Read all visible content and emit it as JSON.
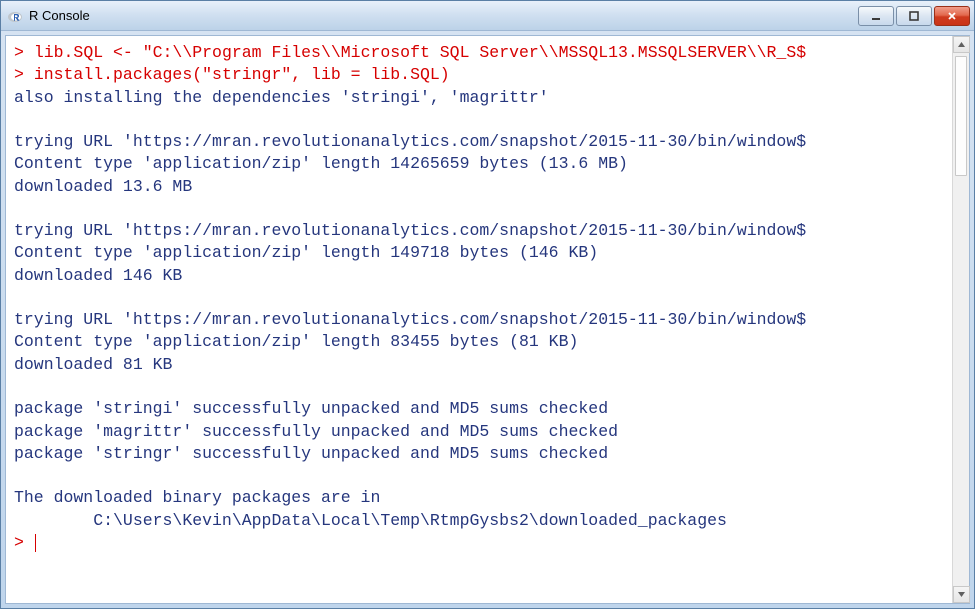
{
  "window": {
    "title": "R Console"
  },
  "console": {
    "prompt": ">",
    "lines": {
      "cmd1": "lib.SQL <- \"C:\\\\Program Files\\\\Microsoft SQL Server\\\\MSSQL13.MSSQLSERVER\\\\R_S$",
      "cmd2": "install.packages(\"stringr\", lib = lib.SQL)",
      "out1": "also installing the dependencies 'stringi', 'magrittr'",
      "out2": "trying URL 'https://mran.revolutionanalytics.com/snapshot/2015-11-30/bin/window$",
      "out3": "Content type 'application/zip' length 14265659 bytes (13.6 MB)",
      "out4": "downloaded 13.6 MB",
      "out5": "trying URL 'https://mran.revolutionanalytics.com/snapshot/2015-11-30/bin/window$",
      "out6": "Content type 'application/zip' length 149718 bytes (146 KB)",
      "out7": "downloaded 146 KB",
      "out8": "trying URL 'https://mran.revolutionanalytics.com/snapshot/2015-11-30/bin/window$",
      "out9": "Content type 'application/zip' length 83455 bytes (81 KB)",
      "out10": "downloaded 81 KB",
      "out11": "package 'stringi' successfully unpacked and MD5 sums checked",
      "out12": "package 'magrittr' successfully unpacked and MD5 sums checked",
      "out13": "package 'stringr' successfully unpacked and MD5 sums checked",
      "out14": "The downloaded binary packages are in",
      "out15": "        C:\\Users\\Kevin\\AppData\\Local\\Temp\\RtmpGysbs2\\downloaded_packages"
    }
  }
}
